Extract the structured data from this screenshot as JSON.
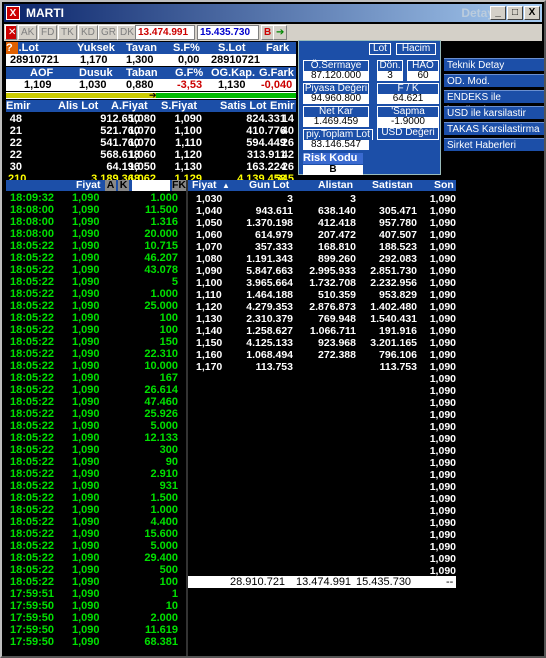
{
  "window": {
    "icon": "X",
    "title": "MARTI",
    "title_right": "Detay",
    "min": "_",
    "max": "□",
    "close": "X"
  },
  "toolbar": {
    "buttons": [
      "AK",
      "FD",
      "TK",
      "KD",
      "GR",
      "DK"
    ],
    "field1": "13.474.991",
    "field2": "15.435.730",
    "b_label": "B"
  },
  "summary": {
    "h1": [
      "G.Lot",
      "Yuksek",
      "Tavan",
      "S.F%",
      "S.Lot",
      "Fark"
    ],
    "v1": [
      "28910721",
      "1,170",
      "1,300",
      "0,00",
      "28910721",
      ""
    ],
    "h2": [
      "AOF",
      "Dusuk",
      "Taban",
      "G.F%",
      "OG.Kap.",
      "G.Fark"
    ],
    "v2": [
      "1,109",
      "1,030",
      "0,880",
      "-3,53",
      "1,130",
      "-0,040"
    ]
  },
  "depth": {
    "headers": [
      "Emir",
      "Alis Lot",
      "A.Fiyat",
      "S.Fiyat",
      "Satis Lot",
      "Emir"
    ],
    "rows": [
      [
        "48",
        "912.650",
        "1,080",
        "1,090",
        "824.331",
        "14"
      ],
      [
        "21",
        "521.760",
        "1,070",
        "1,100",
        "410.776",
        "40"
      ],
      [
        "22",
        "541.760",
        "1,070",
        "1,110",
        "594.449",
        "26"
      ],
      [
        "22",
        "568.618",
        "1,060",
        "1,120",
        "313.911",
        "42"
      ],
      [
        "30",
        "64.196",
        "1,050",
        "1,130",
        "163.224",
        "26"
      ]
    ],
    "total": [
      "210",
      "3.189.368",
      "1,062",
      "1,129",
      "4.139.458",
      "345"
    ]
  },
  "panel": {
    "lot": "Lot",
    "hacim": "Hacim",
    "o_sermaye": "Ö.Sermaye",
    "o_sermaye_val": "87.120.000",
    "don": "Dön.",
    "don_val": "3",
    "hao": "HAO",
    "hao_val": "60",
    "piyasa": "Piyasa Değeri",
    "piyasa_val": "94.960.800",
    "fk": "F / K",
    "fk_val": "64.621",
    "netkar": "Net Kar",
    "netkar_val": "1.469.459",
    "sapma": "'Sapma",
    "sapma_val": "-1.9000",
    "piy_toplam": "piy.Toplam Lot",
    "piy_toplam_val": "83.146.547",
    "usd": "USD Değeri",
    "risk": "Risk Kodu",
    "risk_val": "B"
  },
  "menu": [
    "Teknik Detay",
    "OD. Mod.",
    "ENDEKS ile karsilastir",
    "USD ile karsilastir",
    "TAKAS Karsilastirma",
    "Sirket Haberleri"
  ],
  "trades_header": {
    "time": "",
    "price": "Fiyat",
    "a": "A",
    "k": "K",
    "lot": "",
    "fk": "FK"
  },
  "trades": [
    [
      "18:09:32",
      "1,090",
      "1.000"
    ],
    [
      "18:08:00",
      "1,090",
      "11.500"
    ],
    [
      "18:08:00",
      "1,090",
      "1.316"
    ],
    [
      "18:08:00",
      "1,090",
      "20.000"
    ],
    [
      "18:05:22",
      "1,090",
      "10.715"
    ],
    [
      "18:05:22",
      "1,090",
      "46.207"
    ],
    [
      "18:05:22",
      "1,090",
      "43.078"
    ],
    [
      "18:05:22",
      "1,090",
      "5"
    ],
    [
      "18:05:22",
      "1,090",
      "1.000"
    ],
    [
      "18:05:22",
      "1,090",
      "25.000"
    ],
    [
      "18:05:22",
      "1,090",
      "100"
    ],
    [
      "18:05:22",
      "1,090",
      "100"
    ],
    [
      "18:05:22",
      "1,090",
      "150"
    ],
    [
      "18:05:22",
      "1,090",
      "22.310"
    ],
    [
      "18:05:22",
      "1,090",
      "10.000"
    ],
    [
      "18:05:22",
      "1,090",
      "167"
    ],
    [
      "18:05:22",
      "1,090",
      "26.614"
    ],
    [
      "18:05:22",
      "1,090",
      "47.460"
    ],
    [
      "18:05:22",
      "1,090",
      "25.926"
    ],
    [
      "18:05:22",
      "1,090",
      "5.000"
    ],
    [
      "18:05:22",
      "1,090",
      "12.133"
    ],
    [
      "18:05:22",
      "1,090",
      "300"
    ],
    [
      "18:05:22",
      "1,090",
      "90"
    ],
    [
      "18:05:22",
      "1,090",
      "2.910"
    ],
    [
      "18:05:22",
      "1,090",
      "931"
    ],
    [
      "18:05:22",
      "1,090",
      "1.500"
    ],
    [
      "18:05:22",
      "1,090",
      "1.000"
    ],
    [
      "18:05:22",
      "1,090",
      "4.400"
    ],
    [
      "18:05:22",
      "1,090",
      "15.600"
    ],
    [
      "18:05:22",
      "1,090",
      "5.000"
    ],
    [
      "18:05:22",
      "1,090",
      "29.400"
    ],
    [
      "18:05:22",
      "1,090",
      "500"
    ],
    [
      "18:05:22",
      "1,090",
      "100"
    ],
    [
      "17:59:51",
      "1,090",
      "1"
    ],
    [
      "17:59:50",
      "1,090",
      "10"
    ],
    [
      "17:59:50",
      "1,090",
      "2.000"
    ],
    [
      "17:59:50",
      "1,090",
      "11.619"
    ],
    [
      "17:59:50",
      "1,090",
      "68.381"
    ]
  ],
  "levels_header": [
    "Fiyat",
    "Gun Lot",
    "Alistan",
    "Satistan",
    "Son"
  ],
  "levels": [
    [
      "1,030",
      "3",
      "3",
      "",
      ""
    ],
    [
      "1,040",
      "943.611",
      "638.140",
      "305.471",
      ""
    ],
    [
      "1,050",
      "1.370.198",
      "412.418",
      "957.780",
      ""
    ],
    [
      "1,060",
      "614.979",
      "207.472",
      "407.507",
      ""
    ],
    [
      "1,070",
      "357.333",
      "168.810",
      "188.523",
      ""
    ],
    [
      "1,080",
      "1.191.343",
      "899.260",
      "292.083",
      ""
    ],
    [
      "1,090",
      "5.847.663",
      "2.995.933",
      "2.851.730",
      ""
    ],
    [
      "1,100",
      "3.965.664",
      "1.732.708",
      "2.232.956",
      ""
    ],
    [
      "1,110",
      "1.464.188",
      "510.359",
      "953.829",
      ""
    ],
    [
      "1,120",
      "4.279.353",
      "2.876.873",
      "1.402.480",
      ""
    ],
    [
      "1,130",
      "2.310.379",
      "769.948",
      "1.540.431",
      ""
    ],
    [
      "1,140",
      "1.258.627",
      "1.066.711",
      "191.916",
      ""
    ],
    [
      "1,150",
      "4.125.133",
      "923.968",
      "3.201.165",
      ""
    ],
    [
      "1,160",
      "1.068.494",
      "272.388",
      "796.106",
      ""
    ],
    [
      "1,170",
      "113.753",
      "",
      "113.753",
      ""
    ]
  ],
  "son_value": "1,090",
  "totals": {
    "total": "28.910.721",
    "alis": "13.474.991",
    "satis": "15.435.730",
    "dash": "--"
  }
}
